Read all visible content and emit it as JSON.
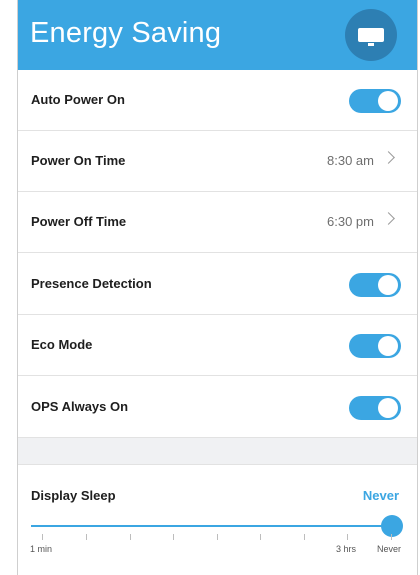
{
  "header": {
    "title": "Energy Saving",
    "icon": "display-icon"
  },
  "settings": {
    "auto_power_on": {
      "label": "Auto Power On",
      "enabled": true
    },
    "power_on_time": {
      "label": "Power On Time",
      "value": "8:30 am"
    },
    "power_off_time": {
      "label": "Power Off Time",
      "value": "6:30 pm"
    },
    "presence_detection": {
      "label": "Presence Detection",
      "enabled": true
    },
    "eco_mode": {
      "label": "Eco Mode",
      "enabled": true
    },
    "ops_always_on": {
      "label": "OPS Always On",
      "enabled": true
    }
  },
  "display_sleep": {
    "label": "Display Sleep",
    "value": "Never",
    "min_label": "1 min",
    "near_max_label": "3 hrs",
    "max_label": "Never",
    "level": 1.0
  },
  "colors": {
    "accent": "#3ba6e2",
    "header_dark": "#2d7fb3"
  }
}
